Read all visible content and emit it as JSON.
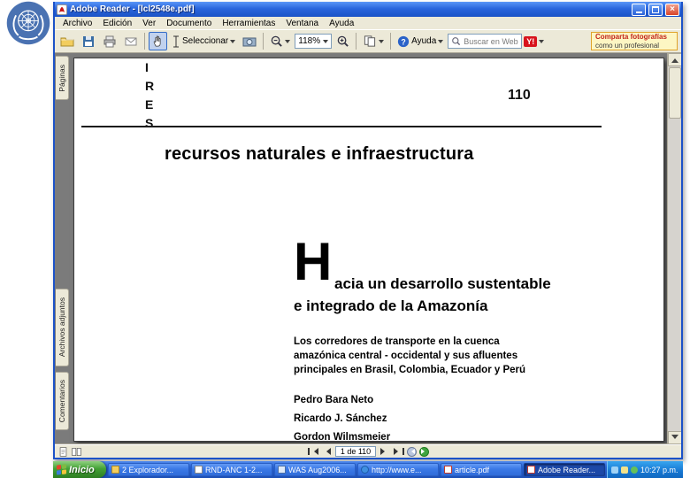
{
  "window": {
    "title": "Adobe Reader - [lcl2548e.pdf]",
    "controls": {
      "close": "×"
    },
    "menus": [
      "Archivo",
      "Edición",
      "Ver",
      "Documento",
      "Herramientas",
      "Ventana",
      "Ayuda"
    ],
    "toolbar": {
      "select_label": "Seleccionar",
      "zoom_level": "118%",
      "help_label": "Ayuda",
      "search_placeholder": "Buscar en Web",
      "yahoo_badge": "Y!",
      "ad_line1": "Comparta fotografías",
      "ad_line2": "como un profesional"
    },
    "sidebar_tabs": [
      {
        "label": "Páginas"
      },
      {
        "label": "Archivos adjuntos"
      },
      {
        "label": "Comentarios"
      }
    ],
    "statusbar": {
      "page_indicator": "1 de 110"
    }
  },
  "document_page": {
    "series_word_letters": [
      "I",
      "R",
      "E",
      "S"
    ],
    "series_number": "110",
    "series_title": "recursos naturales e infraestructura",
    "title_dropcap": "H",
    "title_rest_line1": "acia un desarrollo sustentable",
    "title_line2": "e integrado de la Amazonía",
    "subtitle_line1": "Los corredores de transporte en la cuenca",
    "subtitle_line2": "amazónica central - occidental y sus afluentes",
    "subtitle_line3": "principales en Brasil, Colombia, Ecuador y Perú",
    "authors": [
      "Pedro Bara Neto",
      "Ricardo J. Sánchez",
      "Gordon Wilmsmeier"
    ]
  },
  "taskbar": {
    "start_label": "Inicio",
    "buttons": [
      {
        "label": "2 Explorador..."
      },
      {
        "label": "RND-ANC 1-2..."
      },
      {
        "label": "WAS Aug2006..."
      },
      {
        "label": "http://www.e..."
      },
      {
        "label": "article.pdf"
      },
      {
        "label": "Adobe Reader..."
      }
    ],
    "clock": "10:27 p.m."
  }
}
